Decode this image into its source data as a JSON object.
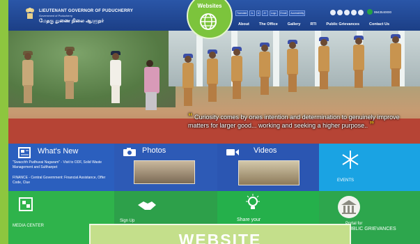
{
  "header": {
    "title": "LIEUTENANT GOVERNOR OF PUDUCHERRY",
    "subtitle": "Government of Puducherry",
    "tamil": "மேதகு துணை நிலை ஆளுநர்",
    "topbar": [
      "Translate",
      "A-",
      "A",
      "A+",
      "Logo",
      "Email",
      "Accessibility"
    ],
    "phone": "9943540000",
    "nav": [
      "About",
      "The Office",
      "Gallery",
      "RTI",
      "Public Grievances",
      "Contact Us"
    ]
  },
  "badge": {
    "label": "Websites",
    "icon": "globe-icon"
  },
  "hero": {
    "quote": "Curiosity comes by ones intention and determination to genuinely improve matters for larger good... working and seeking a higher purpose.."
  },
  "tiles": {
    "whats_new": {
      "title": "What's New",
      "news": [
        "\"Swacchh Pudhuvai Nagaram\" - Visit to ODF, Solid Waste Management and Sulthanpet",
        "FINANCE - Central Government: Financial Assistance, Offer Code, Clue"
      ],
      "icon": "newspaper-icon"
    },
    "photos": {
      "title": "Photos",
      "icon": "camera-icon"
    },
    "videos": {
      "title": "Videos",
      "icon": "video-camera-icon"
    },
    "events": {
      "title": "EVENTS",
      "icon": "firework-icon"
    },
    "media_center": {
      "title": "MEDIA CENTER",
      "icon": "media-icon"
    },
    "sign_up": {
      "title": "Sign Up",
      "icon": "handshake-icon"
    },
    "share": {
      "title": "Share your",
      "icon": "lightbulb-icon"
    },
    "portal": {
      "line1": "Portal for",
      "line2": "PUBLIC GRIEVANCES",
      "icon": "building-icon"
    }
  },
  "banner": {
    "label": "WEBSITE"
  },
  "colors": {
    "header": "#2a56a8",
    "green": "#8dc63f",
    "tile_blue": "#2a5bb8",
    "tile_cyan": "#1ca1e0",
    "tile_green": "#2db44a"
  }
}
